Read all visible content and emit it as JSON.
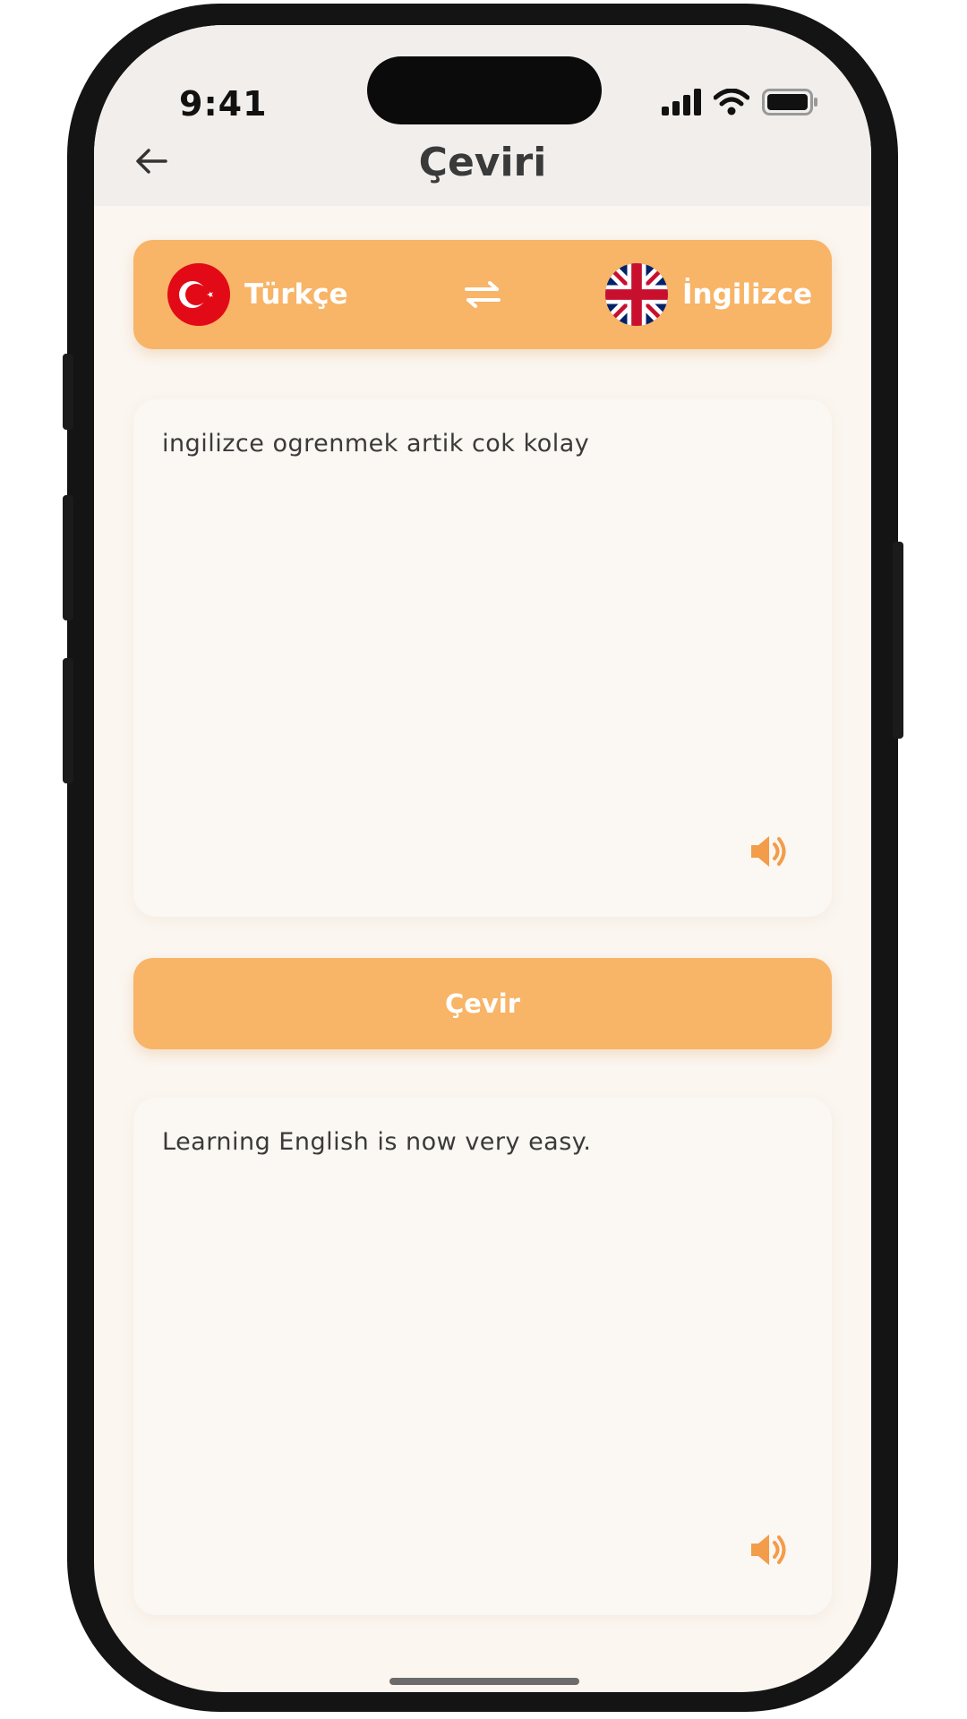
{
  "status": {
    "time": "9:41"
  },
  "header": {
    "title": "Çeviri",
    "back_icon": "arrow-left-icon"
  },
  "languages": {
    "source": {
      "label": "Türkçe",
      "flag": "turkey-flag-icon"
    },
    "target": {
      "label": "İngilizce",
      "flag": "uk-flag-icon"
    },
    "swap_icon": "swap-arrows-icon"
  },
  "input": {
    "text": "ingilizce ogrenmek artik cok kolay"
  },
  "action": {
    "translate_label": "Çevir"
  },
  "output": {
    "text": "Learning English is now very easy."
  },
  "colors": {
    "accent": "#f8b467",
    "background": "#fbf6f0",
    "text": "#3a3a3a"
  }
}
